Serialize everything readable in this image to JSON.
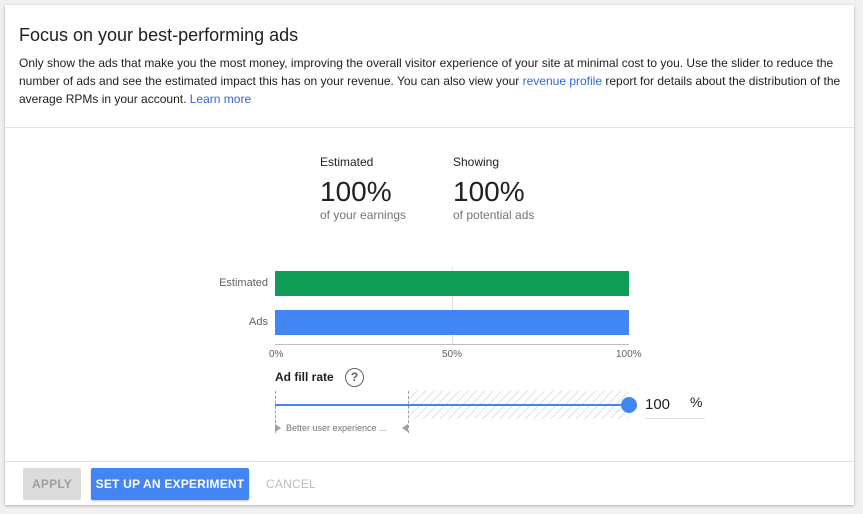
{
  "header": {
    "title": "Focus on your best-performing ads",
    "desc_before_link": "Only show the ads that make you the most money, improving the overall visitor experience of your site at minimal cost to you. Use the slider to reduce the number of ads and see the estimated impact this has on your revenue. You can also view your ",
    "revenue_profile_link": "revenue profile",
    "desc_after_link": " report for details about the distribution of the average RPMs in your account. ",
    "learn_more_link": "Learn more"
  },
  "metrics": {
    "earnings": {
      "label": "Estimated",
      "value": "100%",
      "caption": "of your earnings"
    },
    "ads": {
      "label": "Showing",
      "value": "100%",
      "caption": "of potential ads"
    }
  },
  "chart_data": {
    "type": "bar",
    "orientation": "horizontal",
    "categories": [
      "Estimated",
      "Ads"
    ],
    "values": [
      100,
      100
    ],
    "x_ticks": [
      "0%",
      "50%",
      "100%"
    ],
    "xlim": [
      0,
      100
    ],
    "colors": [
      "#0f9d58",
      "#4285f4"
    ]
  },
  "slider": {
    "label": "Ad fill rate",
    "help_icon": "help-circle-icon",
    "value": 100,
    "unit": "%",
    "ux_hint": "Better user experience ...",
    "accent": "#4285f4"
  },
  "footer": {
    "apply_label": "APPLY",
    "experiment_label": "SET UP AN EXPERIMENT",
    "cancel_label": "CANCEL"
  }
}
